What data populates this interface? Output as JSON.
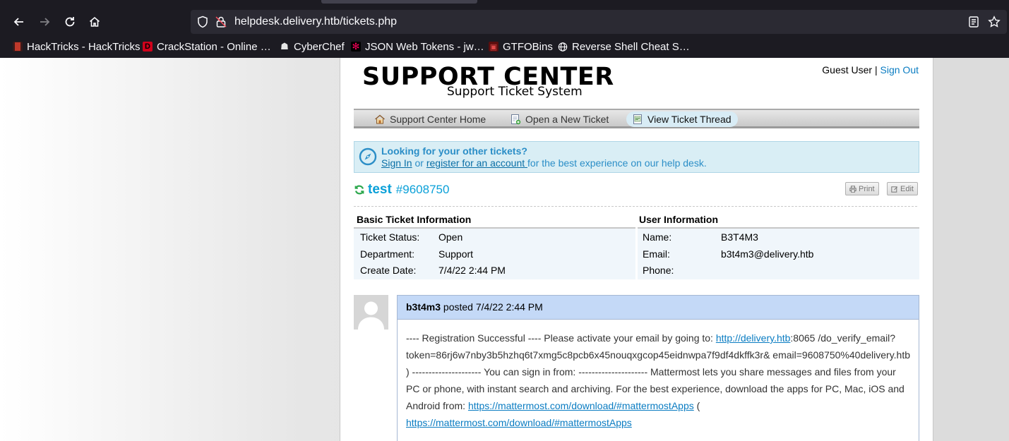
{
  "browser": {
    "url": "helpdesk.delivery.htb/tickets.php",
    "bookmarks": [
      {
        "label": "HackTricks - HackTricks",
        "icon": "hacktricks-icon"
      },
      {
        "label": "CrackStation - Online …",
        "icon": "crackstation-icon"
      },
      {
        "label": "CyberChef",
        "icon": "cyberchef-icon"
      },
      {
        "label": "JSON Web Tokens - jw…",
        "icon": "jwt-icon"
      },
      {
        "label": "GTFOBins",
        "icon": "gtfobins-icon"
      },
      {
        "label": "Reverse Shell Cheat S…",
        "icon": "globe-icon"
      }
    ]
  },
  "header": {
    "logo_main": "SUPPORT CENTER",
    "logo_sub": "Support Ticket System",
    "guest": "Guest User",
    "separator": "|",
    "sign_out": "Sign Out"
  },
  "nav": {
    "items": [
      {
        "label": "Support Center Home",
        "icon": "home-icon"
      },
      {
        "label": "Open a New Ticket",
        "icon": "new-ticket-icon"
      },
      {
        "label": "View Ticket Thread",
        "icon": "ticket-thread-icon",
        "active": true
      }
    ]
  },
  "notice": {
    "title": "Looking for your other tickets?",
    "sign_in": "Sign In",
    "or": " or ",
    "register": "register for an account ",
    "tail": "for the best experience on our help desk."
  },
  "ticket": {
    "subject": "test",
    "number": "#9608750",
    "print_label": "Print",
    "edit_label": "Edit",
    "basic": {
      "heading": "Basic Ticket Information",
      "rows": [
        {
          "label": "Ticket Status:",
          "value": "Open"
        },
        {
          "label": "Department:",
          "value": "Support"
        },
        {
          "label": "Create Date:",
          "value": "7/4/22 2:44 PM"
        }
      ]
    },
    "user": {
      "heading": "User Information",
      "rows": [
        {
          "label": "Name:",
          "value": "B3T4M3"
        },
        {
          "label": "Email:",
          "value": "b3t4m3@delivery.htb"
        },
        {
          "label": "Phone:",
          "value": ""
        }
      ]
    }
  },
  "thread": {
    "poster": "b3t4m3",
    "posted_text": " posted 7/4/22 2:44 PM",
    "body_pre": "---- Registration Successful ---- Please activate your email by going to: ",
    "link1": "http://delivery.htb",
    "body_mid": ":8065 /do_verify_email?token=86rj6w7nby3b5hzhq6t7xmg5c8pcb6x45nouqxgcop45eidnwpa7f9df4dkffk3r& email=9608750%40delivery.htb ) --------------------- You can sign in from: --------------------- Mattermost lets you share messages and files from your PC or phone, with instant search and archiving. For the best experience, download the apps for PC, Mac, iOS and Android from: ",
    "link2": "https://mattermost.com/download/#mattermostApps",
    "body_mid2": " ( ",
    "link3": "https://mattermost.com/download/#mattermostApps"
  }
}
